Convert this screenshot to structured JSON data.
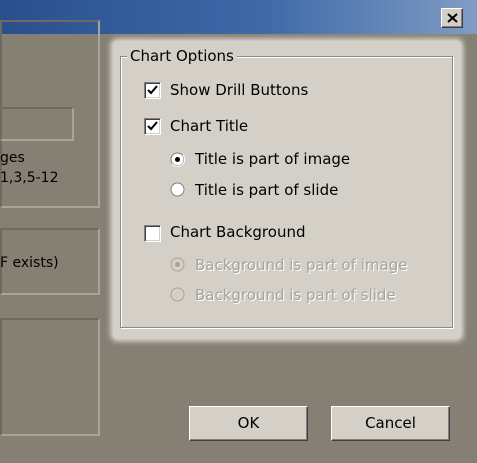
{
  "dialog": {
    "close_glyph": "×",
    "left_panel": {
      "pages_label": "ges",
      "pages_example": "1,3,5-12",
      "exists_text": "F exists)"
    },
    "chart_options": {
      "title": "Chart Options",
      "show_drill_buttons": {
        "label": "Show Drill Buttons",
        "checked": true
      },
      "chart_title": {
        "label": "Chart Title",
        "checked": true
      },
      "title_radio": [
        {
          "label": "Title is part of image",
          "selected": true
        },
        {
          "label": "Title is part of slide",
          "selected": false
        }
      ],
      "chart_background": {
        "label": "Chart Background",
        "checked": false
      },
      "background_radio": [
        {
          "label": "Background is part of image",
          "selected": true,
          "disabled": true
        },
        {
          "label": "Background is part of slide",
          "selected": false,
          "disabled": true
        }
      ]
    },
    "buttons": {
      "ok": "OK",
      "cancel": "Cancel"
    }
  }
}
